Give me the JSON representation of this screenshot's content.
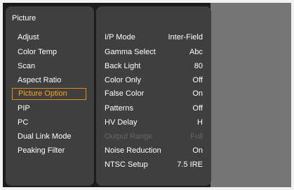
{
  "menu": {
    "title": "Picture",
    "items": [
      {
        "label": "Adjust"
      },
      {
        "label": "Color Temp"
      },
      {
        "label": "Scan"
      },
      {
        "label": "Aspect Ratio"
      },
      {
        "label": "Picture Option",
        "selected": true
      },
      {
        "label": "PIP"
      },
      {
        "label": "PC"
      },
      {
        "label": "Dual Link Mode"
      },
      {
        "label": "Peaking Filter"
      }
    ]
  },
  "options": [
    {
      "label": "I/P Mode",
      "value": "Inter-Field"
    },
    {
      "label": "Gamma Select",
      "value": "Abc"
    },
    {
      "label": "Back Light",
      "value": "80"
    },
    {
      "label": "Color Only",
      "value": "Off"
    },
    {
      "label": "False Color",
      "value": "On"
    },
    {
      "label": "Patterns",
      "value": "Off"
    },
    {
      "label": "HV Delay",
      "value": "H"
    },
    {
      "label": "Output Range",
      "value": "Full",
      "disabled": true
    },
    {
      "label": "Noise Reduction",
      "value": "On"
    },
    {
      "label": "NTSC Setup",
      "value": "7.5 IRE"
    }
  ],
  "colors": {
    "selection_border": "#e08a1a",
    "selection_text": "#f5a623",
    "panel_bg": "#3f3f3f",
    "screen_bg": "#1c1c1c",
    "preview_bg": "#757575",
    "disabled_text": "#666666"
  }
}
